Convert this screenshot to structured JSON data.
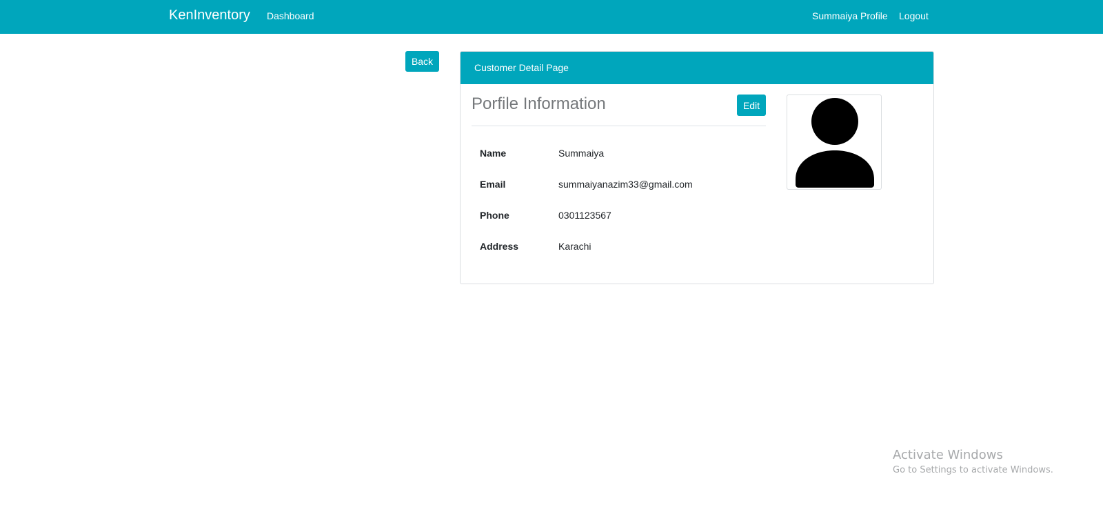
{
  "navbar": {
    "brand": "KenInventory",
    "dashboard_link": "Dashboard",
    "profile_link": "Summaiya Profile",
    "logout_link": "Logout",
    "background_color": "#00a6bc"
  },
  "back_button": "Back",
  "card": {
    "header": "Customer Detail Page",
    "section_title": "Porfile Information",
    "edit_button": "Edit",
    "fields": [
      {
        "label": "Name",
        "value": "Summaiya"
      },
      {
        "label": "Email",
        "value": "summaiyanazim33@gmail.com"
      },
      {
        "label": "Phone",
        "value": "0301123567"
      },
      {
        "label": "Address",
        "value": "Karachi"
      }
    ],
    "avatar_icon": "user-silhouette-icon"
  },
  "watermark": {
    "title": "Activate Windows",
    "subtitle": "Go to Settings to activate Windows."
  }
}
